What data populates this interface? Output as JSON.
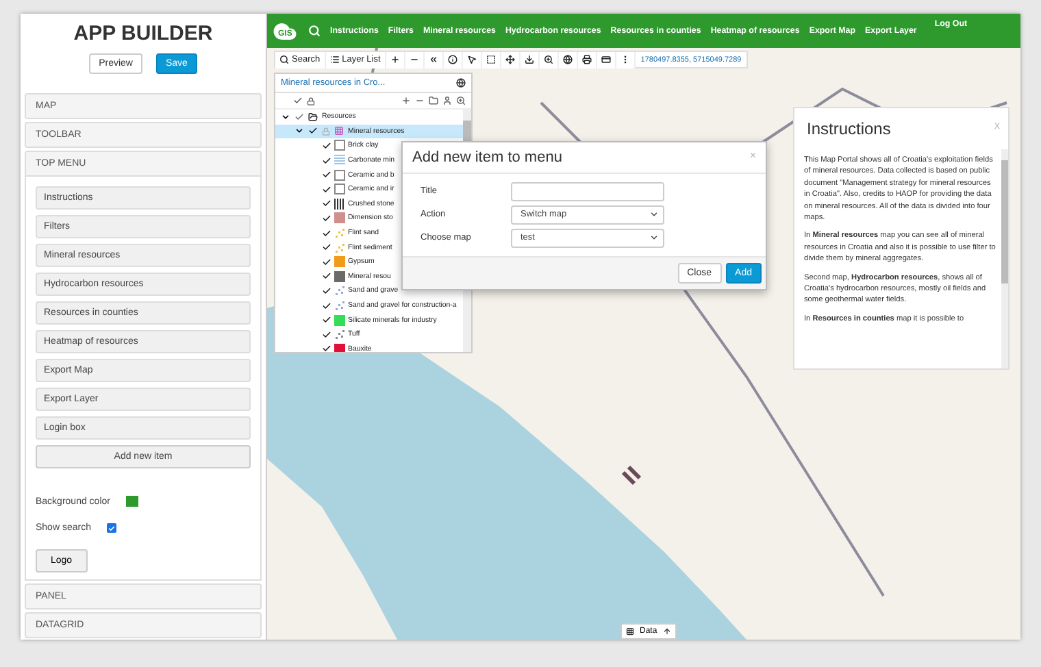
{
  "builder": {
    "title": "APP BUILDER",
    "buttons": [
      {
        "label": "Preview",
        "kind": "plain"
      },
      {
        "label": "Save",
        "kind": "primary"
      }
    ],
    "sections": [
      {
        "label": "MAP",
        "expanded": false
      },
      {
        "label": "TOOLBAR",
        "expanded": false
      },
      {
        "label": "TOP MENU",
        "expanded": true
      },
      {
        "label": "PANEL",
        "expanded": false
      },
      {
        "label": "DATAGRID",
        "expanded": false
      }
    ],
    "menu_items": [
      "Instructions",
      "Filters",
      "Mineral resources",
      "Hydrocarbon resources",
      "Resources in counties",
      "Heatmap of resources",
      "Export Map",
      "Export Layer",
      "Login box"
    ],
    "add_button": "Add new item",
    "background_color": {
      "label": "Background color",
      "color": "#2e9a2e"
    },
    "show_search": {
      "label": "Show search",
      "checked": true
    },
    "logo_button": "Logo"
  },
  "topbar": {
    "logo_text": "GIS",
    "items": [
      "Instructions",
      "Filters",
      "Mineral resources",
      "Hydrocarbon resources",
      "Resources in counties",
      "Heatmap of resources",
      "Export Map",
      "Export Layer"
    ],
    "logout": "Log Out"
  },
  "toolbar": {
    "search": "Search",
    "layer_list": "Layer List",
    "coordinates": "1780497.8355, 5715049.7289"
  },
  "layer_panel": {
    "title": "Mineral resources in Cro...",
    "tree": [
      {
        "label": "Resources",
        "checked": true,
        "expanded": true,
        "selected": false,
        "children": [
          {
            "label": "Mineral resources",
            "checked": true,
            "expanded": true,
            "selected": true,
            "children": [
              {
                "label": "Brick clay",
                "checked": true,
                "kind": "outline",
                "color": "#888888"
              },
              {
                "label": "Carbonate min",
                "checked": true,
                "kind": "lines",
                "color": "#9fc5e8"
              },
              {
                "label": "Ceramic and b",
                "checked": true,
                "kind": "outline",
                "color": "#888888"
              },
              {
                "label": "Ceramic and ir",
                "checked": true,
                "kind": "outline",
                "color": "#888888"
              },
              {
                "label": "Crushed stone",
                "checked": true,
                "kind": "bars",
                "color": "#333333"
              },
              {
                "label": "Dimension sto",
                "checked": true,
                "kind": "square",
                "color": "#d08f8f"
              },
              {
                "label": "Flint sand",
                "checked": true,
                "kind": "dots",
                "color": "#f0c040"
              },
              {
                "label": "Flint sediment",
                "checked": true,
                "kind": "dots",
                "color": "#f0c040"
              },
              {
                "label": "Gypsum",
                "checked": true,
                "kind": "square",
                "color": "#f29a1a"
              },
              {
                "label": "Mineral resou",
                "checked": true,
                "kind": "square",
                "color": "#6a6a6a"
              },
              {
                "label": "Sand and grave",
                "checked": true,
                "kind": "dots",
                "color": "#9aa8d8"
              },
              {
                "label": "Sand and gravel for construction-a",
                "checked": true,
                "kind": "dots",
                "color": "#9aa8d8"
              },
              {
                "label": "Silicate minerals for industry",
                "checked": true,
                "kind": "square",
                "color": "#33dd55"
              },
              {
                "label": "Tuff",
                "checked": true,
                "kind": "dots",
                "color": "#888888"
              },
              {
                "label": "Bauxite",
                "checked": true,
                "kind": "square",
                "color": "#e0103a"
              }
            ]
          }
        ]
      }
    ]
  },
  "dialog": {
    "title": "Add new item to menu",
    "close": "×",
    "fields": [
      {
        "label": "Title",
        "kind": "text"
      },
      {
        "label": "Action",
        "kind": "select",
        "value": "Switch map"
      },
      {
        "label": "Choose map",
        "kind": "select",
        "value": "test"
      }
    ],
    "buttons": [
      {
        "label": "Close",
        "kind": "plain"
      },
      {
        "label": "Add",
        "kind": "primary"
      }
    ]
  },
  "instructions": {
    "title": "Instructions",
    "close": "x",
    "paragraphs": [
      "This Map Portal shows all of Croatia's exploitation fields of mineral resources. Data collected is based on public document \"Management strategy for mineral resources in Croatia\". Also, credits to HAOP for providing the data on mineral resources. All of the data is divided into four maps.",
      "In **Mineral resources** map you can see all of mineral resources in Croatia and also it is possible to use filter to divide them by mineral aggregates.",
      "Second map, **Hydrocarbon resources**, shows all of Croatia's hydrocarbon resources, mostly oil fields and some geothermal water fields.",
      "In **Resources in counties** map it is possible to"
    ]
  },
  "data_button": "Data"
}
